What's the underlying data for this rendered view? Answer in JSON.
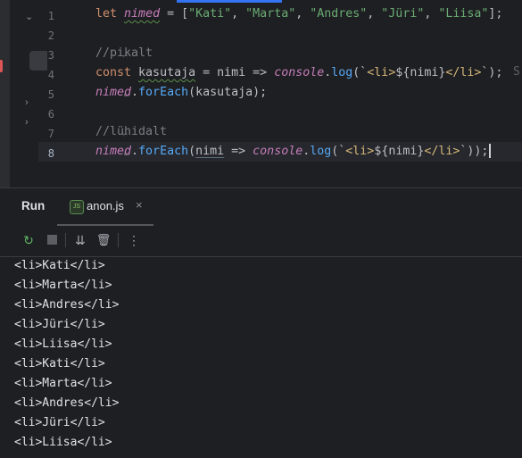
{
  "editor": {
    "line_numbers": [
      "1",
      "2",
      "3",
      "4",
      "5",
      "6",
      "7",
      "8"
    ],
    "current_line": "8",
    "lines": {
      "l1": {
        "kw": "let",
        "var": "nimed",
        "eq": " = [",
        "s1": "\"Kati\"",
        "s2": "\"Marta\"",
        "s3": "\"Andres\"",
        "s4": "\"Jüri\"",
        "s5": "\"Liisa\"",
        "comma": ", ",
        "end": "];"
      },
      "l3": {
        "comment": "//pikalt"
      },
      "l4": {
        "kw": "const",
        "var": "kasutaja",
        "eq": " = ",
        "param": "nimi",
        "arrow": " => ",
        "console": "console",
        "dot": ".",
        "log": "log",
        "open": "(`",
        "tag1": "<li>",
        "interp": "${nimi}",
        "tag2": "</li>",
        "close": "`);"
      },
      "l5": {
        "var": "nimed",
        "dot": ".",
        "fn": "forEach",
        "arg": "(kasutaja);"
      },
      "l7": {
        "comment": "//lühidalt"
      },
      "l8": {
        "var": "nimed",
        "dot": ".",
        "fn": "forEach",
        "open": "(",
        "param": "nimi",
        "arrow": " => ",
        "console": "console",
        "dot2": ".",
        "log": "log",
        "open2": "(`",
        "tag1": "<li>",
        "interp": "${nimi}",
        "tag2": "</li>",
        "close": "`));"
      },
      "overflow_hint": "S"
    }
  },
  "run_panel": {
    "title": "Run",
    "tab": {
      "icon": "js-file-icon",
      "icon_text": "JS",
      "label": "anon.js",
      "close": "×"
    },
    "toolbar": {
      "rerun": "↻",
      "stop": "stop",
      "scroll_end": "⇊",
      "clear": "🗑",
      "more": "⋮"
    },
    "output": [
      "<li>Kati</li>",
      "<li>Marta</li>",
      "<li>Andres</li>",
      "<li>Jüri</li>",
      "<li>Liisa</li>",
      "<li>Kati</li>",
      "<li>Marta</li>",
      "<li>Andres</li>",
      "<li>Jüri</li>",
      "<li>Liisa</li>"
    ]
  },
  "colors": {
    "accent": "#3574f0",
    "keyword": "#cf8e6d",
    "string": "#6aab73",
    "variable": "#c77dbb",
    "function": "#56a8f5",
    "comment": "#7a7e85"
  }
}
